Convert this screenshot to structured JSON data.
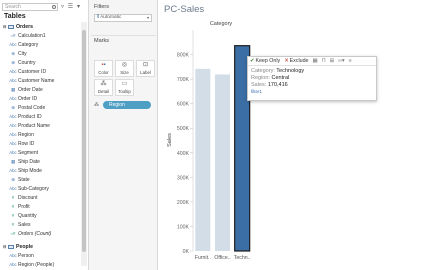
{
  "search": {
    "placeholder": "Search"
  },
  "toolbar": {
    "filter_icon": "filter-icon",
    "view_icon": "list-view-icon",
    "more_icon": "more-menu-icon"
  },
  "tables_title": "Tables",
  "groups": [
    {
      "name": "Orders",
      "fields": [
        {
          "label": "Calculation1",
          "kind": "calc",
          "icon": "=#"
        },
        {
          "label": "Category",
          "kind": "dim",
          "icon": "Abc"
        },
        {
          "label": "City",
          "kind": "geo",
          "icon": "⊕"
        },
        {
          "label": "Country",
          "kind": "geo",
          "icon": "⊕"
        },
        {
          "label": "Customer ID",
          "kind": "dim",
          "icon": "Abc"
        },
        {
          "label": "Customer Name",
          "kind": "dim",
          "icon": "Abc"
        },
        {
          "label": "Order Date",
          "kind": "date",
          "icon": "▦"
        },
        {
          "label": "Order ID",
          "kind": "dim",
          "icon": "Abc"
        },
        {
          "label": "Postal Code",
          "kind": "geo",
          "icon": "⊕"
        },
        {
          "label": "Product ID",
          "kind": "dim",
          "icon": "Abc"
        },
        {
          "label": "Product Name",
          "kind": "dim",
          "icon": "Abc"
        },
        {
          "label": "Region",
          "kind": "dim",
          "icon": "Abc"
        },
        {
          "label": "Row ID",
          "kind": "dim",
          "icon": "Abc"
        },
        {
          "label": "Segment",
          "kind": "dim",
          "icon": "Abc"
        },
        {
          "label": "Ship Date",
          "kind": "date",
          "icon": "▦"
        },
        {
          "label": "Ship Mode",
          "kind": "dim",
          "icon": "Abc"
        },
        {
          "label": "State",
          "kind": "geo",
          "icon": "⊕"
        },
        {
          "label": "Sub-Category",
          "kind": "dim",
          "icon": "Abc"
        },
        {
          "label": "Discount",
          "kind": "mea",
          "icon": "#"
        },
        {
          "label": "Profit",
          "kind": "mea",
          "icon": "#"
        },
        {
          "label": "Quantity",
          "kind": "mea",
          "icon": "#"
        },
        {
          "label": "Sales",
          "kind": "mea",
          "icon": "#"
        },
        {
          "label": "Orders (Count)",
          "kind": "mea",
          "icon": "=#",
          "italic": true
        }
      ]
    },
    {
      "name": "People",
      "fields": [
        {
          "label": "Person",
          "kind": "dim",
          "icon": "Abc"
        },
        {
          "label": "Region (People)",
          "kind": "dim",
          "icon": "Abc"
        }
      ]
    }
  ],
  "filters_label": "Filters",
  "marks": {
    "label": "Marks",
    "type": "Automatic",
    "buttons": [
      {
        "label": "Color",
        "icon": "color-icon"
      },
      {
        "label": "Size",
        "icon": "size-icon"
      },
      {
        "label": "Label",
        "icon": "label-icon"
      },
      {
        "label": "Detail",
        "icon": "detail-icon"
      },
      {
        "label": "Tooltip",
        "icon": "tooltip-icon"
      }
    ],
    "pill": "Region"
  },
  "sheet_title": "PC-Sales",
  "chart_data": {
    "type": "bar",
    "column_header": "Category",
    "categories": [
      "Furnit..",
      "Office..",
      "Techn.."
    ],
    "values": [
      741718,
      719047,
      836154
    ],
    "ylabel": "Sales",
    "ylim": [
      0,
      900000
    ],
    "yticks": [
      0,
      100000,
      200000,
      300000,
      400000,
      500000,
      600000,
      700000,
      800000
    ],
    "ytick_labels": [
      "0K",
      "100K",
      "200K",
      "300K",
      "400K",
      "500K",
      "600K",
      "700K",
      "800K"
    ],
    "selected_index": 2,
    "colors": {
      "bar": "#d3dde7",
      "selected": "#3b6ea5",
      "selected_border": "#1d1d1d"
    }
  },
  "tooltip": {
    "keep_only": "Keep Only",
    "exclude": "Exclude",
    "rows": [
      {
        "key": "Category:",
        "value": "Technology"
      },
      {
        "key": "Region:",
        "value": "Central"
      },
      {
        "key": "Sales:",
        "value": "170,416"
      }
    ],
    "footer": "filter1"
  }
}
